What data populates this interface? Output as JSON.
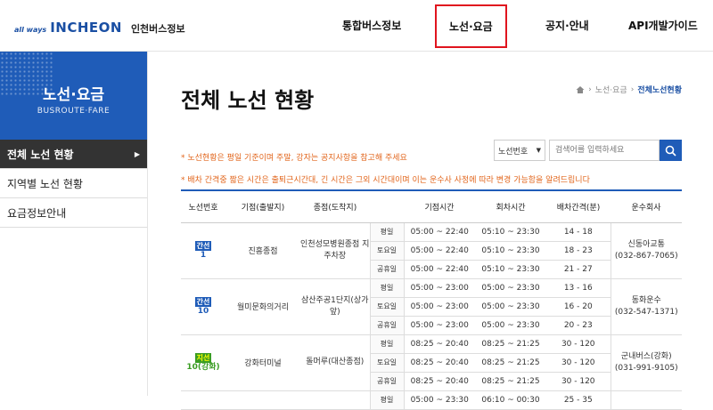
{
  "header": {
    "logo_tag": "all ways",
    "logo_brand": "INCHEON",
    "site_name": "인천버스정보",
    "nav": [
      "통합버스정보",
      "노선·요금",
      "공지·안내",
      "API개발가이드"
    ]
  },
  "sidebar": {
    "title": "노선·요금",
    "subtitle": "BUSROUTE·FARE",
    "items": [
      {
        "label": "전체 노선 현황",
        "active": true
      },
      {
        "label": "지역별 노선 현황",
        "active": false
      },
      {
        "label": "요금정보안내",
        "active": false
      }
    ]
  },
  "page": {
    "title": "전체 노선 현황",
    "breadcrumb": {
      "parent": "노선·요금",
      "current": "전체노선현황"
    },
    "notice1": "* 노선현황은 평일 기준이며 주말, 강자는 공지사항을 참고해 주세요",
    "notice2": "* 배차 간격중 짧은 시간은 출퇴근시간대, 긴 시간은 그외 시간대이며 이는 운수사 사정에 따라 변경 가능함을 알려드립니다"
  },
  "search": {
    "select_value": "노선번호",
    "placeholder": "검색어를 입력하세요",
    "icon": "search-icon"
  },
  "colors": {
    "accent": "#1f5cb8",
    "notice": "#e2661d",
    "trunk": "#3a9d23"
  },
  "table": {
    "headers": [
      "노선번호",
      "기점(출발지)",
      "종점(도착지)",
      "",
      "기점시간",
      "회차시간",
      "배차간격(분)",
      "운수회사"
    ],
    "routes": [
      {
        "badge": "간선",
        "number": "1",
        "badge_color": "blue",
        "origin": "진흥종점",
        "dest": "인천성모병원종점 지주차장",
        "rows": [
          {
            "day": "평일",
            "start": "05:00 ~ 22:40",
            "turn": "05:10 ~ 23:30",
            "interval": "14 - 18"
          },
          {
            "day": "토요일",
            "start": "05:00 ~ 22:40",
            "turn": "05:10 ~ 23:30",
            "interval": "18 - 23"
          },
          {
            "day": "공휴일",
            "start": "05:00 ~ 22:40",
            "turn": "05:10 ~ 23:30",
            "interval": "21 - 27"
          }
        ],
        "company": "신동아교통",
        "phone": "(032-867-7065)"
      },
      {
        "badge": "간선",
        "number": "10",
        "badge_color": "blue",
        "origin": "월미문화의거리",
        "dest": "삼산주공1단지(상가앞)",
        "rows": [
          {
            "day": "평일",
            "start": "05:00 ~ 23:00",
            "turn": "05:00 ~ 23:30",
            "interval": "13 - 16"
          },
          {
            "day": "토요일",
            "start": "05:00 ~ 23:00",
            "turn": "05:00 ~ 23:30",
            "interval": "16 - 20"
          },
          {
            "day": "공휴일",
            "start": "05:00 ~ 23:00",
            "turn": "05:00 ~ 23:30",
            "interval": "20 - 23"
          }
        ],
        "company": "동화운수",
        "phone": "(032-547-1371)"
      },
      {
        "badge": "지선",
        "number": "10(강화)",
        "badge_color": "green",
        "origin": "강화터미널",
        "dest": "돌머루(대산종점)",
        "rows": [
          {
            "day": "평일",
            "start": "08:25 ~ 20:40",
            "turn": "08:25 ~ 21:25",
            "interval": "30 - 120"
          },
          {
            "day": "토요일",
            "start": "08:25 ~ 20:40",
            "turn": "08:25 ~ 21:25",
            "interval": "30 - 120"
          },
          {
            "day": "공휴일",
            "start": "08:25 ~ 20:40",
            "turn": "08:25 ~ 21:25",
            "interval": "30 - 120"
          }
        ],
        "company": "군내버스(강화)",
        "phone": "(031-991-9105)"
      }
    ],
    "partial_row": {
      "day": "평일",
      "start": "05:00 ~ 23:30",
      "turn": "06:10 ~ 00:30",
      "interval": "25 - 35"
    }
  }
}
